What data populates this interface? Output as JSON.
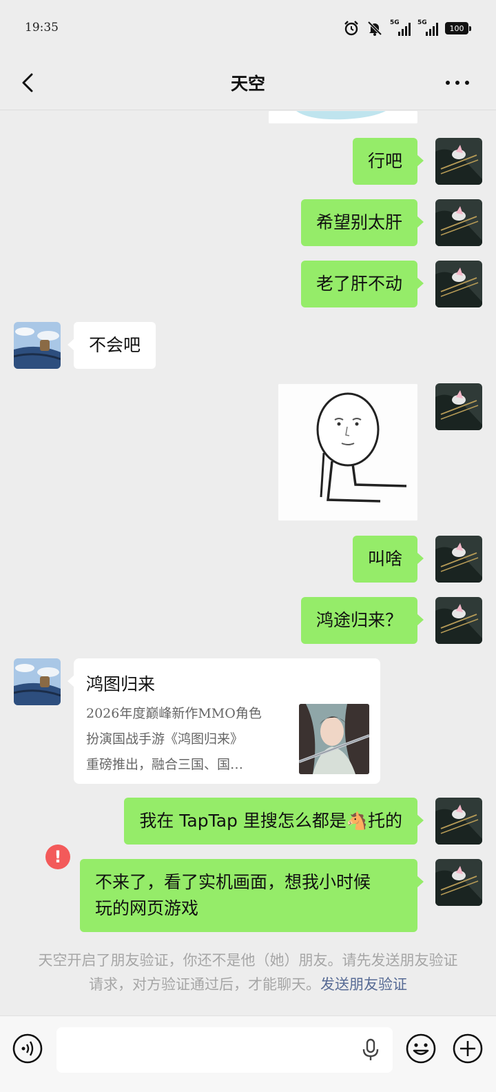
{
  "status_bar": {
    "time": "19:35",
    "signal_1_label": "5G",
    "signal_2_label": "5G",
    "battery": "100"
  },
  "header": {
    "title": "天空"
  },
  "messages": {
    "m1": "行吧",
    "m2": "希望别太肝",
    "m3": "老了肝不动",
    "m4": "不会吧",
    "m6": "叫啥",
    "m7": "鸿途归来？",
    "m9": "我在 TapTap 里搜怎么都是🐴托的",
    "m10_line1": "不来了，看了实机画面，想我小时候",
    "m10_line2": "玩的网页游戏"
  },
  "link_card": {
    "title": "鸿图归来",
    "desc_line1": "2026年度巅峰新作MMO角色",
    "desc_line2": "扮演国战手游《鸿图归来》",
    "desc_line3": "重磅推出，融合三国、国…"
  },
  "failed_indicator": "!",
  "system_notice": {
    "text": "天空开启了朋友验证，你还不是他（她）朋友。请先发送朋友验证请求，对方验证通过后，才能聊天。",
    "link": "发送朋友验证"
  },
  "colors": {
    "my_bubble": "#95ec69",
    "other_bubble": "#ffffff",
    "background": "#ededed",
    "link": "#576b95",
    "error": "#f35a5a"
  },
  "icons": [
    "back-arrow-icon",
    "more-icon",
    "voice-icon",
    "microphone-icon",
    "emoji-icon",
    "plus-icon",
    "alarm-icon",
    "mute-icon"
  ]
}
